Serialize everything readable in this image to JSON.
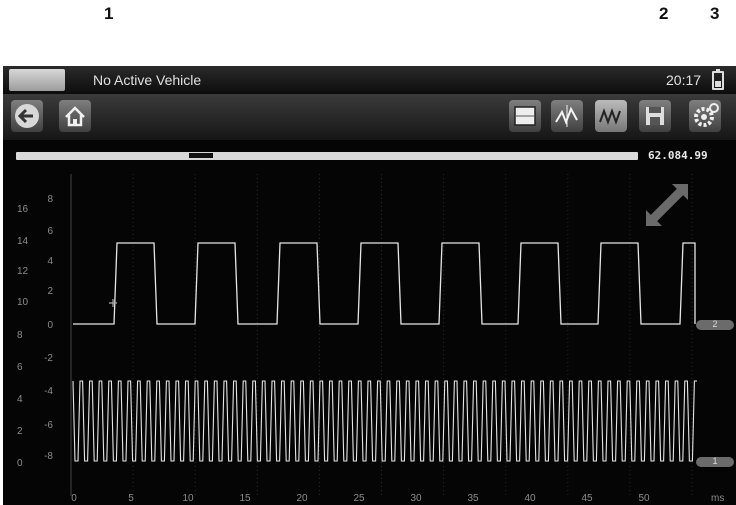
{
  "callouts": [
    "1",
    "2",
    "3"
  ],
  "header": {
    "vehicle": "No Active Vehicle",
    "time": "20:17"
  },
  "toolbar": {
    "back": "back-icon",
    "home": "home-icon",
    "right_buttons": [
      "split-screen-icon",
      "pattern-icon",
      "trace-icon",
      "save-icon",
      "settings-icon"
    ]
  },
  "scroll": {
    "position": "62.084.99"
  },
  "scale": {
    "outer": [
      "16",
      "14",
      "12",
      "10",
      "8",
      "6",
      "4",
      "2",
      "0"
    ],
    "inner": [
      "8",
      "6",
      "4",
      "2",
      "0",
      "-2",
      "-4",
      "-6",
      "-8"
    ],
    "x": [
      "0",
      "5",
      "10",
      "15",
      "20",
      "25",
      "30",
      "35",
      "40",
      "45",
      "50"
    ],
    "x_unit": "ms"
  },
  "markers": {
    "trace2": "2",
    "trace1": "1"
  },
  "colors": {
    "trace": "#e6e6e6",
    "background": "#050505"
  }
}
